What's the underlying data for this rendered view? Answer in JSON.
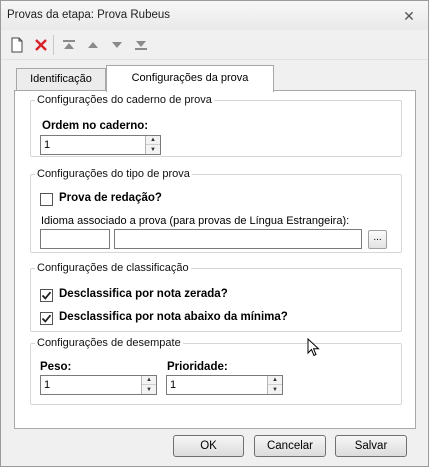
{
  "window": {
    "title": "Provas da etapa: Prova Rubeus",
    "close_icon": "close-icon"
  },
  "toolbar": {
    "items": [
      "new-document-icon",
      "delete-icon",
      "move-first-icon",
      "move-up-icon",
      "move-down-icon",
      "move-last-icon"
    ]
  },
  "tabs": {
    "identificacao": "Identificação",
    "configuracoes": "Configurações da prova",
    "active": "configuracoes"
  },
  "caderno": {
    "legend": "Configurações do caderno de prova",
    "ordem_label": "Ordem no caderno:",
    "ordem_value": "1"
  },
  "tipo": {
    "legend": "Configurações do tipo de prova",
    "redacao_label": "Prova de redação?",
    "redacao_checked": false,
    "idioma_label": "Idioma associado a prova (para provas de Língua Estrangeira):",
    "idioma_code": "",
    "idioma_name": "",
    "browse_label": "..."
  },
  "classificacao": {
    "legend": "Configurações de classificação",
    "zerada_label": "Desclassifica por nota zerada?",
    "zerada_checked": true,
    "minima_label": "Desclassifica por nota abaixo da mínima?",
    "minima_checked": true
  },
  "desempate": {
    "legend": "Configurações de desempate",
    "peso_label": "Peso:",
    "peso_value": "1",
    "prioridade_label": "Prioridade:",
    "prioridade_value": "1"
  },
  "buttons": {
    "ok": "OK",
    "cancelar": "Cancelar",
    "salvar": "Salvar"
  }
}
